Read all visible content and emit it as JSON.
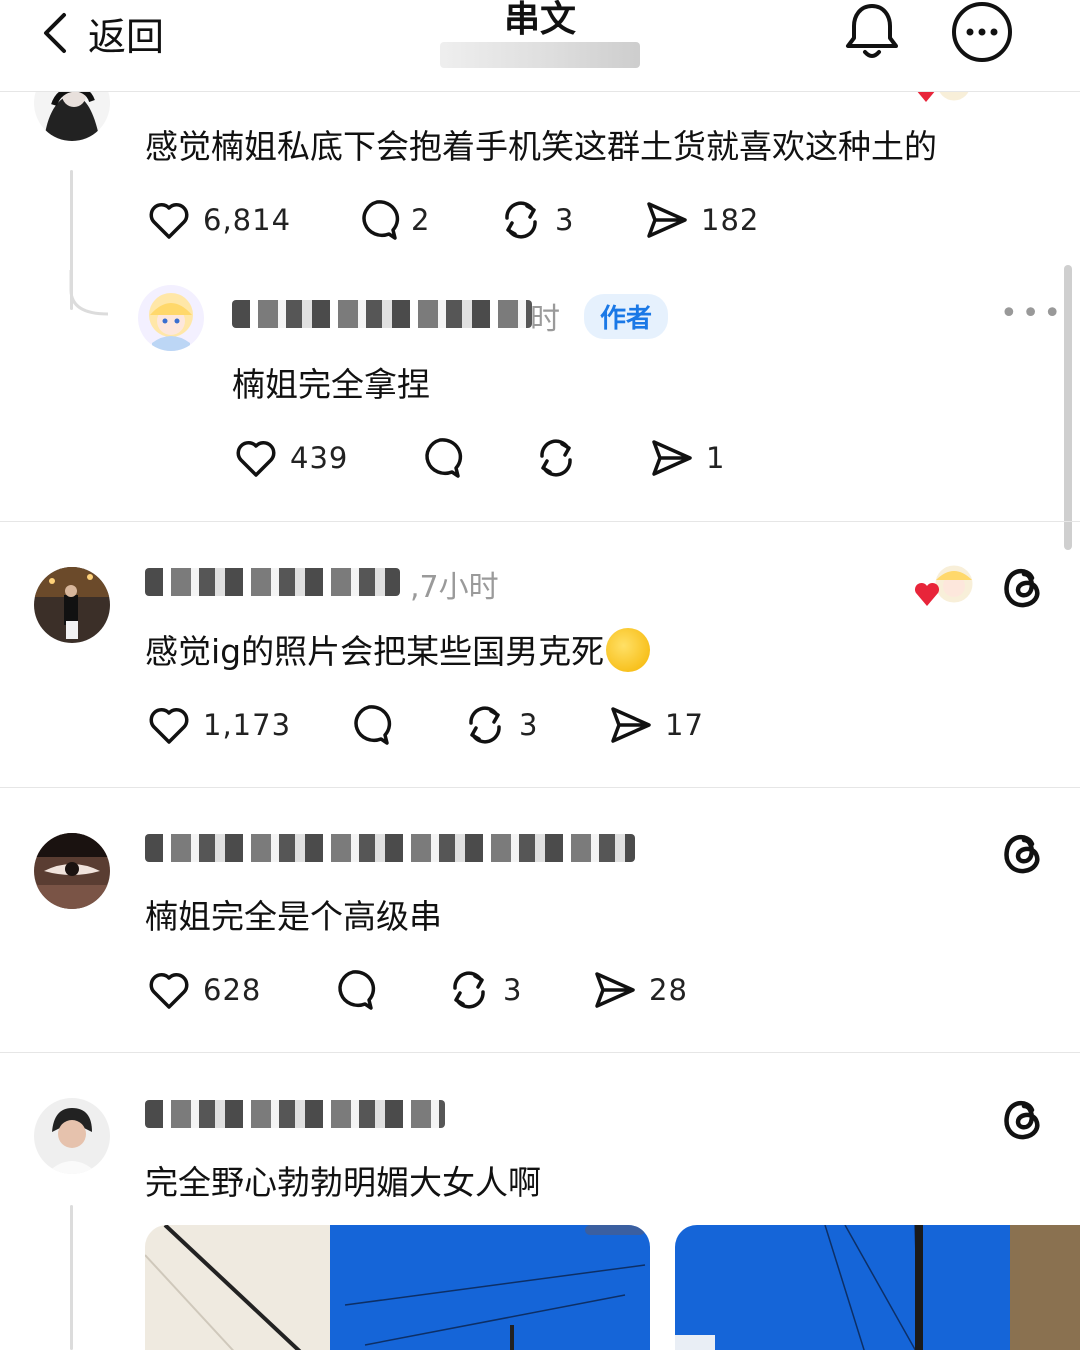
{
  "header": {
    "back_label": "返回",
    "title": "串文"
  },
  "posts": [
    {
      "text": "感觉楠姐私底下会抱着手机笑这群土货就喜欢这种土的",
      "likes": "6,814",
      "comments": "2",
      "reposts": "3",
      "shares": "182"
    },
    {
      "time": "时",
      "author_badge": "作者",
      "text": "楠姐完全拿捏",
      "likes": "439",
      "comments": "",
      "reposts": "",
      "shares": "1"
    },
    {
      "time": ",7小时",
      "text": "感觉ig的照片会把某些国男克死",
      "likes": "1,173",
      "comments": "",
      "reposts": "3",
      "shares": "17"
    },
    {
      "text": "楠姐完全是个高级串",
      "likes": "628",
      "comments": "",
      "reposts": "3",
      "shares": "28"
    },
    {
      "text": "完全野心勃勃明媚大女人啊"
    }
  ],
  "colors": {
    "heart_red": "#e8253a",
    "author_badge_bg": "#e6f1fd",
    "author_badge_text": "#1a78e6",
    "sky_blue": "#1565d8"
  }
}
